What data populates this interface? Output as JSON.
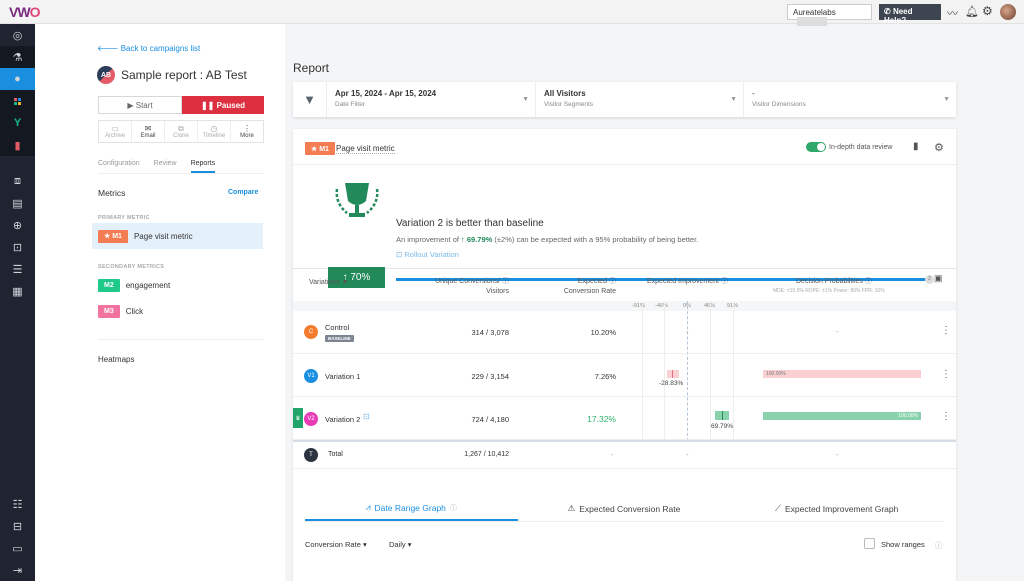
{
  "topbar": {
    "logo_a": "VW",
    "logo_b": "O",
    "account": "Aureatelabs",
    "help_label": "Need Help?"
  },
  "sidenav": {
    "items": [
      "dashboard-icon",
      "testing-icon",
      "ab-test-icon",
      "apps-icon",
      "funnel-icon",
      "mobile-icon",
      "deploy-icon",
      "list-icon",
      "target-icon",
      "feedback-icon",
      "data-icon",
      "calendar-icon"
    ],
    "bottom": [
      "settings-sliders-icon",
      "briefcase-icon",
      "screen-icon",
      "collapse-icon"
    ]
  },
  "left": {
    "back_label": "Back to campaigns list",
    "ab_badge": "AB",
    "title": "Sample report : AB Test",
    "start_label": "Start",
    "paused_label": "Paused",
    "actions": [
      {
        "label": "Archive",
        "icon": "▭"
      },
      {
        "label": "Email",
        "icon": "✉"
      },
      {
        "label": "Clone",
        "icon": "⧉"
      },
      {
        "label": "Timeline",
        "icon": "◷"
      },
      {
        "label": "More",
        "icon": "⋮"
      }
    ],
    "tabs": [
      "Configuration",
      "Review",
      "Reports"
    ],
    "metrics_heading": "Metrics",
    "compare_label": "Compare",
    "primary_label": "PRIMARY METRIC",
    "secondary_label": "SECONDARY METRICS",
    "primary": {
      "badge": "★ M1",
      "name": "Page visit metric",
      "color": "#f47c52"
    },
    "secondary": [
      {
        "badge": "M2",
        "name": "engagement",
        "color": "#1ec98a"
      },
      {
        "badge": "M3",
        "name": "Click",
        "color": "#f373a0"
      }
    ],
    "heatmaps_label": "Heatmaps"
  },
  "report": {
    "heading": "Report",
    "filters": [
      {
        "value": "Apr 15, 2024 - Apr 15, 2024",
        "label": "Date Filter"
      },
      {
        "value": "All Visitors",
        "label": "Visitor Segments"
      },
      {
        "value": "-",
        "label": "Visitor Dimensions"
      }
    ],
    "metric_badge": "★ M1",
    "metric_name": "Page visit metric",
    "indepth_label": "In-depth data review",
    "indepth_on": true,
    "summary": {
      "title": "Variation 2 is better than baseline",
      "desc_prefix": "An improvement of",
      "desc_value": "↑ 69.79%",
      "desc_suffix": "(±2%) can be expected with a 95% probability of being better.",
      "rollout_label": "Rollout Variation",
      "badge": "↑ 70%",
      "progress_days": "2"
    },
    "table": {
      "headers": {
        "variations": "Variations",
        "uc1": "Unique Conversions/",
        "uc2": "Visitors",
        "ecr1": "Expected",
        "ecr2": "Conversion Rate",
        "ei": "Expected Improvement",
        "dp": "Decision Probabilities",
        "mde": "MDE: ±19.5%  ROPE: ±1%  Power: 80%  FPR: 10%"
      },
      "scale": [
        "-91%",
        "-46%",
        "0%",
        "46%",
        "91%"
      ],
      "rows": [
        {
          "dot": "C",
          "color": "#f47c2c",
          "name": "Control",
          "baseline": "BASELINE",
          "uc": "314 / 3,078",
          "ecr": "10.20%",
          "ei": "-",
          "dp": "-"
        },
        {
          "dot": "V1",
          "color": "#1a8fe0",
          "name": "Variation 1",
          "uc": "229 / 3,154",
          "ecr": "7.26%",
          "ei": "-28.83%",
          "dp": "100.00%"
        },
        {
          "dot": "V2",
          "color": "#e83bb6",
          "name": "Variation 2",
          "uc": "724 / 4,180",
          "ecr": "17.32%",
          "ei": "69.79%",
          "dp": "100.00%"
        }
      ],
      "total": {
        "dot": "T",
        "name": "Total",
        "uc": "1,267 / 10,412",
        "ecr": "-",
        "ei": "-",
        "dp": "-"
      }
    },
    "graph_tabs": [
      "Date Range Graph",
      "Expected Conversion Rate",
      "Expected Improvement Graph"
    ],
    "graph_controls": {
      "metric": "Conversion Rate ▾",
      "period": "Daily ▾",
      "show_ranges": "Show ranges"
    }
  }
}
